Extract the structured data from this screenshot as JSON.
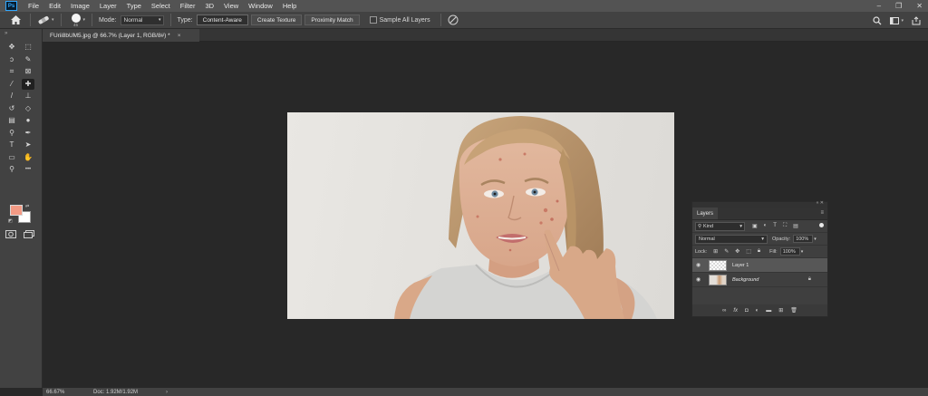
{
  "menu": {
    "logo": "Ps",
    "items": [
      "File",
      "Edit",
      "Image",
      "Layer",
      "Type",
      "Select",
      "Filter",
      "3D",
      "View",
      "Window",
      "Help"
    ]
  },
  "window_controls": {
    "minimize": "–",
    "restore": "❐",
    "close": "✕"
  },
  "options": {
    "brush_size": "45",
    "mode_label": "Mode:",
    "mode_value": "Normal",
    "type_label": "Type:",
    "type_buttons": [
      "Content-Aware",
      "Create Texture",
      "Proximity Match"
    ],
    "active_type": "Content-Aware",
    "sample_all_layers_label": "Sample All Layers",
    "sample_all_layers_checked": false
  },
  "document_tab": {
    "title": "FUrii8bUM5.jpg @ 66.7% (Layer 1, RGB/8#) *",
    "close": "×"
  },
  "tools": [
    {
      "icon": "move-icon",
      "glyph": "✥"
    },
    {
      "icon": "rectangular-marquee-icon",
      "glyph": "⬚"
    },
    {
      "icon": "lasso-icon",
      "glyph": "ↄ"
    },
    {
      "icon": "quick-selection-icon",
      "glyph": "✎"
    },
    {
      "icon": "crop-icon",
      "glyph": "⌗"
    },
    {
      "icon": "frame-icon",
      "glyph": "⊠"
    },
    {
      "icon": "eyedropper-icon",
      "glyph": "⁄"
    },
    {
      "icon": "spot-healing-brush-icon",
      "glyph": "✚",
      "active": true
    },
    {
      "icon": "brush-icon",
      "glyph": "/"
    },
    {
      "icon": "clone-stamp-icon",
      "glyph": "⊥"
    },
    {
      "icon": "history-brush-icon",
      "glyph": "↺"
    },
    {
      "icon": "eraser-icon",
      "glyph": "◇"
    },
    {
      "icon": "gradient-icon",
      "glyph": "▤"
    },
    {
      "icon": "blur-icon",
      "glyph": "●"
    },
    {
      "icon": "dodge-icon",
      "glyph": "⚲"
    },
    {
      "icon": "pen-icon",
      "glyph": "✒"
    },
    {
      "icon": "type-icon",
      "glyph": "T"
    },
    {
      "icon": "path-selection-icon",
      "glyph": "➤"
    },
    {
      "icon": "rectangle-shape-icon",
      "glyph": "▭"
    },
    {
      "icon": "hand-icon",
      "glyph": "✋"
    },
    {
      "icon": "zoom-icon",
      "glyph": "⚲"
    },
    {
      "icon": "more-tools-icon",
      "glyph": "•••"
    }
  ],
  "colors": {
    "foreground": "#f29a84",
    "background": "#ffffff",
    "app_bg": "#282828",
    "panel_bg": "#424242",
    "accent": "#31a8ff"
  },
  "status": {
    "zoom": "66.67%",
    "doc": "Doc: 1.92M/1.92M",
    "arrow": "›"
  },
  "layers_panel": {
    "tab": "Layers",
    "filter_kind": "Kind",
    "blend_mode": "Normal",
    "opacity_label": "Opacity:",
    "opacity_value": "100%",
    "lock_label": "Lock:",
    "fill_label": "Fill:",
    "fill_value": "100%",
    "layers": [
      {
        "name": "Layer 1",
        "selected": true,
        "italic": false,
        "locked": false,
        "visible": true
      },
      {
        "name": "Background",
        "selected": false,
        "italic": true,
        "locked": true,
        "visible": true
      }
    ]
  }
}
